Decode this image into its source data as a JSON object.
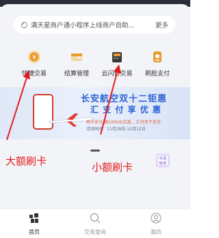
{
  "notice": {
    "text": "满天星商户通小程序上线商户自助...",
    "more": "更多"
  },
  "quick_actions": [
    {
      "label": "快捷交易",
      "icon": "yen-coin-icon"
    },
    {
      "label": "结算管理",
      "icon": "wallet-icon"
    },
    {
      "label": "云闪付交易",
      "icon": "card-terminal-icon"
    },
    {
      "label": "刷脸支付",
      "icon": "face-pay-icon"
    }
  ],
  "banner": {
    "line1": "长安航空双十二钜惠",
    "line2": "汇 支 付 享 优 惠",
    "line3": "刷卡支付 满1000元立减... 汇付天下支付",
    "line4": "活动时间：11月28日-12月12日"
  },
  "annotations": {
    "left": "大额刷卡",
    "right": "小额刷卡"
  },
  "right_icon": {
    "text": "年度账单",
    "name": "annual-bill-icon"
  },
  "tabs": [
    {
      "label": "首页",
      "active": true
    },
    {
      "label": "交易查询",
      "active": false
    },
    {
      "label": "我的",
      "active": false
    }
  ],
  "colors": {
    "accent_red": "#e11c1c",
    "banner_blue": "#2f63d8",
    "icon_gold": "#f0a020"
  }
}
